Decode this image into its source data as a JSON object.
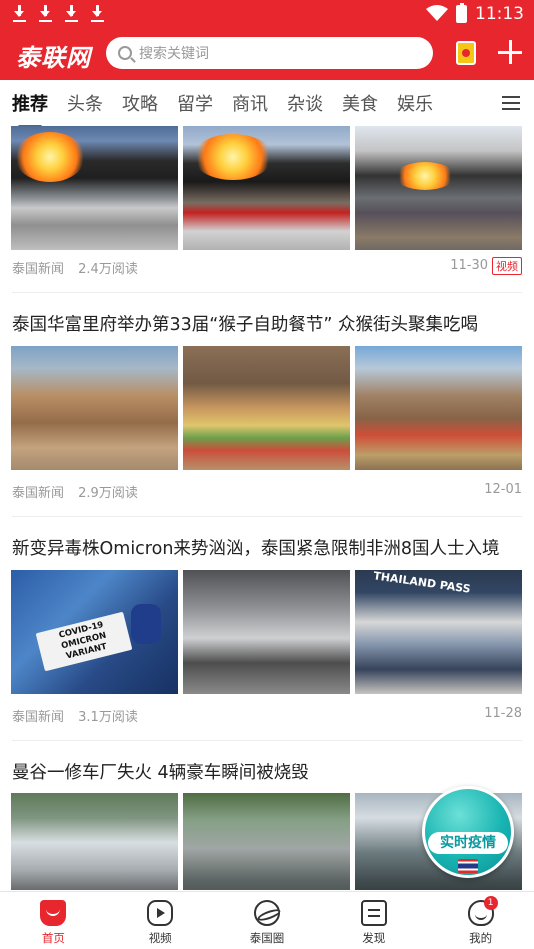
{
  "status_bar": {
    "time": "11:13"
  },
  "app": {
    "logo": "泰联网",
    "search_placeholder": "搜索关键词"
  },
  "tabs": [
    {
      "label": "推荐",
      "active": true
    },
    {
      "label": "头条"
    },
    {
      "label": "攻略"
    },
    {
      "label": "留学"
    },
    {
      "label": "商讯"
    },
    {
      "label": "杂谈"
    },
    {
      "label": "美食"
    },
    {
      "label": "娱乐"
    }
  ],
  "articles": [
    {
      "title": "",
      "source": "泰国新闻",
      "views": "2.4万阅读",
      "date": "11-30",
      "badge": "视频"
    },
    {
      "title": "泰国华富里府举办第33届“猴子自助餐节” 众猴街头聚集吃喝",
      "source": "泰国新闻",
      "views": "2.9万阅读",
      "date": "12-01"
    },
    {
      "title": "新变异毒株Omicron来势汹汹，泰国紧急限制非洲8国人士入境",
      "source": "泰国新闻",
      "views": "3.1万阅读",
      "date": "11-28"
    },
    {
      "title": "曼谷一修车厂失火 4辆豪车瞬间被烧毁"
    }
  ],
  "thumb_text": {
    "covid_vial": "COVID-19 OMICRON VARIANT",
    "thailand_sign": "THAILAND PASS"
  },
  "floating_badge": {
    "label": "实时疫情"
  },
  "bottom_nav": [
    {
      "label": "首页",
      "active": true
    },
    {
      "label": "视频"
    },
    {
      "label": "泰国圈"
    },
    {
      "label": "发现"
    },
    {
      "label": "我的",
      "badge": "1"
    }
  ],
  "colors": {
    "brand": "#e8262d"
  }
}
